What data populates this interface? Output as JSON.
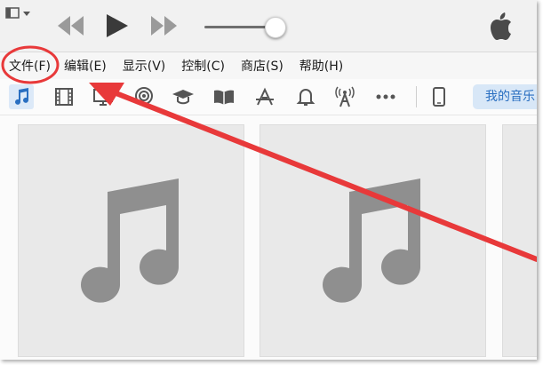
{
  "menubar": {
    "items": [
      {
        "label": "文件(F)"
      },
      {
        "label": "编辑(E)"
      },
      {
        "label": "显示(V)"
      },
      {
        "label": "控制(C)"
      },
      {
        "label": "商店(S)"
      },
      {
        "label": "帮助(H)"
      }
    ]
  },
  "toolbar": {
    "icons": [
      "music-icon",
      "movies-icon",
      "tv-icon",
      "podcasts-icon",
      "itunes-u-icon",
      "books-icon",
      "apps-icon",
      "tones-icon",
      "radio-icon",
      "more-icon",
      "device-icon"
    ],
    "library_label": "我的音乐"
  },
  "player": {
    "volume_level": 0.8
  },
  "colors": {
    "accent_blue": "#2a6fc1",
    "annotation_red": "#e8393a"
  }
}
